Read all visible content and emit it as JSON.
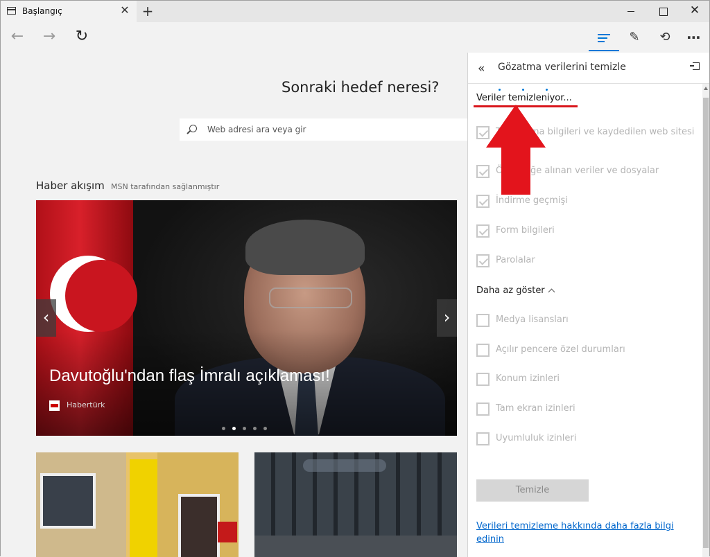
{
  "tab": {
    "title": "Başlangıç"
  },
  "page": {
    "heading": "Sonraki hedef neresi?",
    "search_placeholder": "Web adresi ara veya gir",
    "news_title": "Haber akışım",
    "news_subtitle": "MSN tarafından sağlanmıştır",
    "carousel": {
      "headline": "Davutoğlu'ndan flaş İmralı açıklaması!",
      "source": "Habertürk",
      "slide_count": 5,
      "active_slide": 2
    }
  },
  "panel": {
    "title": "Gözatma verilerini temizle",
    "status": "Veriler temizleniyor...",
    "options_visible": [
      {
        "label": "Tanımlama bilgileri ve kaydedilen web sitesi",
        "checked": true
      },
      {
        "label": "Önbelleğe alınan veriler ve dosyalar",
        "checked": true
      },
      {
        "label": "İndirme geçmişi",
        "checked": true
      },
      {
        "label": "Form bilgileri",
        "checked": true
      },
      {
        "label": "Parolalar",
        "checked": true
      }
    ],
    "toggle_label": "Daha az göster",
    "options_more": [
      {
        "label": "Medya lisansları",
        "checked": false
      },
      {
        "label": "Açılır pencere özel durumları",
        "checked": false
      },
      {
        "label": "Konum izinleri",
        "checked": false
      },
      {
        "label": "Tam ekran izinleri",
        "checked": false
      },
      {
        "label": "Uyumluluk izinleri",
        "checked": false
      }
    ],
    "clear_button": "Temizle",
    "learn_more_link": "Verileri temizleme hakkında daha fazla bilgi edinin"
  },
  "colors": {
    "accent": "#0078d7",
    "annotation": "#e3141c"
  }
}
